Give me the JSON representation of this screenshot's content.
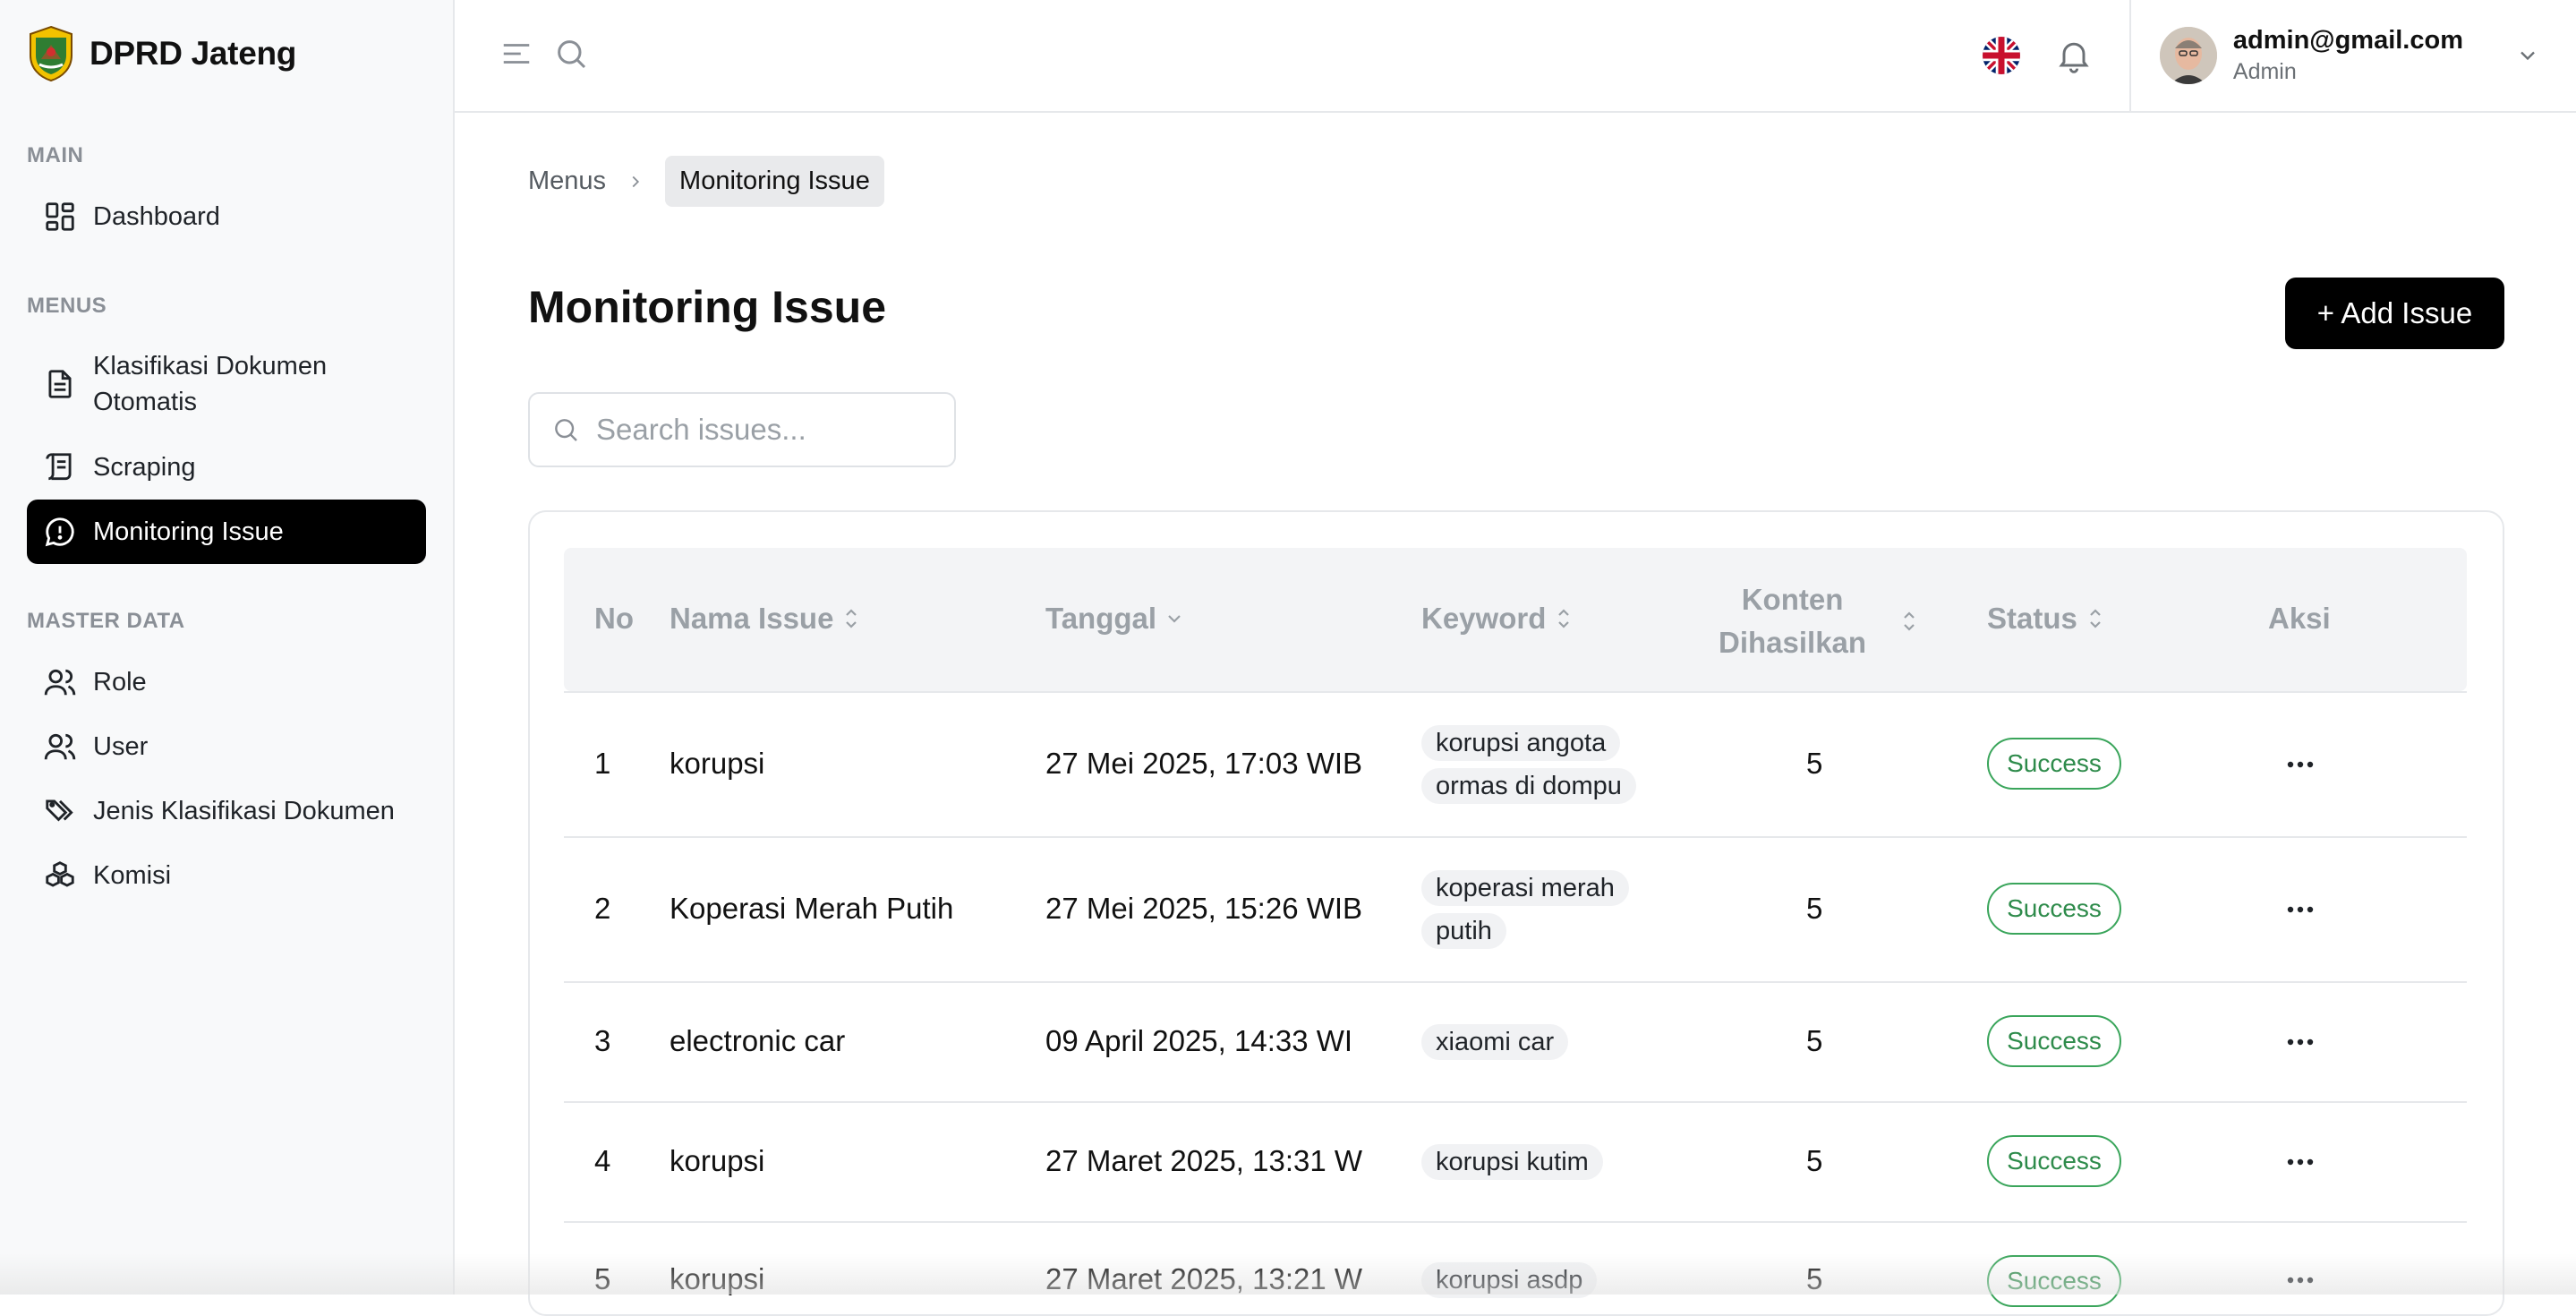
{
  "brand": {
    "title": "DPRD Jateng"
  },
  "sidebar": {
    "sections": [
      {
        "label": "MAIN"
      },
      {
        "label": "MENUS"
      },
      {
        "label": "MASTER DATA"
      }
    ],
    "items": [
      {
        "label": "Dashboard",
        "icon": "dashboard-grid-icon"
      },
      {
        "label": "Klasifikasi Dokumen Otomatis",
        "icon": "document-icon"
      },
      {
        "label": "Scraping",
        "icon": "scroll-icon"
      },
      {
        "label": "Monitoring Issue",
        "icon": "chat-alert-icon",
        "active": true
      },
      {
        "label": "Role",
        "icon": "users-icon"
      },
      {
        "label": "User",
        "icon": "user-icon"
      },
      {
        "label": "Jenis Klasifikasi Dokumen",
        "icon": "tags-icon"
      },
      {
        "label": "Komisi",
        "icon": "boxes-icon"
      }
    ]
  },
  "topbar": {
    "user": {
      "email": "admin@gmail.com",
      "role": "Admin"
    }
  },
  "breadcrumb": {
    "parent": "Menus",
    "current": "Monitoring Issue"
  },
  "page": {
    "title": "Monitoring Issue",
    "add_button": "+ Add Issue"
  },
  "search": {
    "placeholder": "Search issues..."
  },
  "table": {
    "headers": {
      "no": "No",
      "nama_issue": "Nama Issue",
      "tanggal": "Tanggal",
      "keyword": "Keyword",
      "konten_line1": "Konten",
      "konten_line2": "Dihasilkan",
      "status": "Status",
      "aksi": "Aksi"
    },
    "rows": [
      {
        "no": "1",
        "nama": "korupsi",
        "tanggal": "27 Mei 2025, 17:03 WIB",
        "keyword": "korupsi angota ormas di dompu",
        "konten": "5",
        "status": "Success"
      },
      {
        "no": "2",
        "nama": "Koperasi Merah Putih",
        "tanggal": "27 Mei 2025, 15:26 WIB",
        "keyword": "koperasi merah putih",
        "konten": "5",
        "status": "Success"
      },
      {
        "no": "3",
        "nama": "electronic car",
        "tanggal": "09 April 2025, 14:33 WI",
        "keyword": "xiaomi car",
        "konten": "5",
        "status": "Success"
      },
      {
        "no": "4",
        "nama": "korupsi",
        "tanggal": "27 Maret 2025, 13:31 W",
        "keyword": "korupsi kutim",
        "konten": "5",
        "status": "Success"
      },
      {
        "no": "5",
        "nama": "korupsi",
        "tanggal": "27 Maret 2025, 13:21 W",
        "keyword": "korupsi asdp",
        "konten": "5",
        "status": "Success"
      }
    ]
  },
  "colors": {
    "accent": "#000000",
    "success": "#3aa55b",
    "sidebar_bg": "#f8f9fa"
  }
}
